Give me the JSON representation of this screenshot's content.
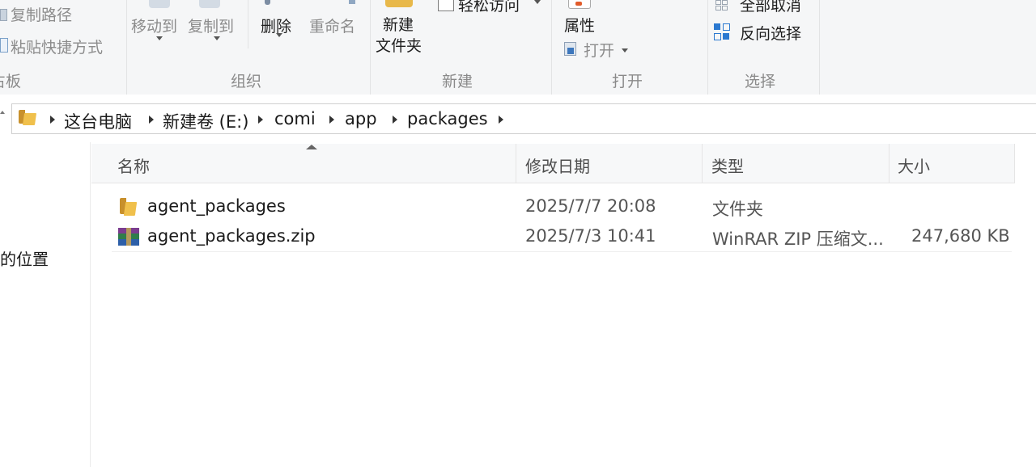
{
  "ribbon": {
    "clipboard": {
      "copy_path": "复制路径",
      "paste_shortcut": "粘贴快捷方式",
      "group_label": "占板"
    },
    "organize": {
      "move_to": "移动到",
      "copy_to": "复制到",
      "delete": "删除",
      "rename": "重命名",
      "group_label": "组织"
    },
    "new": {
      "new_folder_line1": "新建",
      "new_folder_line2": "文件夹",
      "easy_access": "轻松访问",
      "group_label": "新建"
    },
    "open": {
      "properties": "属性",
      "open": "打开",
      "group_label": "打开"
    },
    "select": {
      "select_none": "全部取消",
      "invert_selection": "反向选择",
      "group_label": "选择"
    }
  },
  "address": {
    "crumbs": [
      "这台电脑",
      "新建卷 (E:)",
      "comi",
      "app",
      "packages"
    ]
  },
  "nav": {
    "partial_item": "的位置"
  },
  "columns": {
    "name": "名称",
    "modified": "修改日期",
    "type": "类型",
    "size": "大小"
  },
  "files": [
    {
      "name": "agent_packages",
      "modified": "2025/7/7 20:08",
      "type": "文件夹",
      "size": "",
      "icon": "folder-icon"
    },
    {
      "name": "agent_packages.zip",
      "modified": "2025/7/3 10:41",
      "type": "WinRAR ZIP 压缩文...",
      "size": "247,680 KB",
      "icon": "winrar-archive-icon"
    }
  ],
  "colors": {
    "folder": "#e8b84a",
    "select_blue": "#2b79d0"
  }
}
